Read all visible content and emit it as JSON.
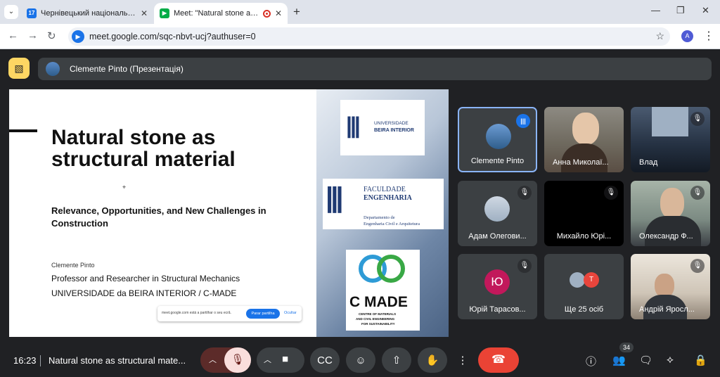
{
  "browser": {
    "tabs": [
      {
        "title": "Чернівецький національний у",
        "favicon": "calendar-icon",
        "label": "17"
      },
      {
        "title": "Meet: \"Natural stone as struc",
        "favicon": "meet-icon",
        "active": true
      }
    ],
    "url": "meet.google.com/sqc-nbvt-ucj?authuser=0",
    "profile_initial": "A"
  },
  "meet": {
    "presenter_bar": "Clemente Pinto (Презентація)",
    "slide": {
      "title": "Natural stone as structural material",
      "subtitle": "Relevance, Opportunities, and New Challenges in Construction",
      "author": "Clemente Pinto",
      "role": "Professor and Researcher in Structural Mechanics",
      "org": "UNIVERSIDADE da BEIRA INTERIOR / C-MADE",
      "share_note_text": "meet.google.com está a partilhar o seu ecrã.",
      "share_note_button": "Parar partilha",
      "share_note_hide": "Ocultar",
      "logo_ubi_line1": "UNIVERSIDADE",
      "logo_ubi_line2": "BEIRA INTERIOR",
      "logo_fe_line1": "FACULDADE",
      "logo_fe_line2": "ENGENHARIA",
      "logo_fe_line3": "Departamento de",
      "logo_fe_line4": "Engenharia Civil e Arquitetura",
      "logo_cmade": "C MADE",
      "logo_cmade_sub1": "CENTRE OF MATERIALS",
      "logo_cmade_sub2": "AND CIVIL ENGINEERING",
      "logo_cmade_sub3": "FOR SUSTAINABILITY"
    },
    "participants": [
      {
        "name": "Clemente Pinto"
      },
      {
        "name": "Анна Миколаї..."
      },
      {
        "name": "Влад"
      },
      {
        "name": "Адам Олегови..."
      },
      {
        "name": "Михайло Юрі..."
      },
      {
        "name": "Олександр Ф..."
      },
      {
        "name": "Юрій Тарасов...",
        "initial": "Ю"
      },
      {
        "name": "Ще 25 осіб",
        "initial": "Т"
      },
      {
        "name": "Андрій Яросл..."
      }
    ],
    "colors": {
      "letter_yu": "#c2185b",
      "letter_t": "#e8453c",
      "end_call": "#ea4335",
      "present_icon": "#fdd663"
    }
  },
  "controls": {
    "time": "16:23",
    "meeting_name": "Natural stone as structural mate...",
    "people_count": "34"
  }
}
